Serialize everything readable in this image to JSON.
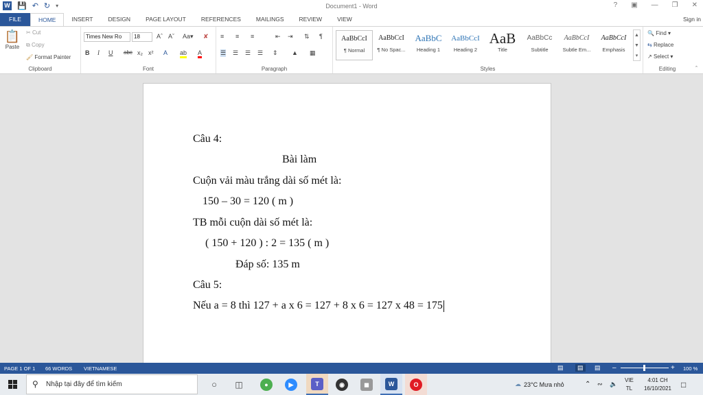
{
  "titlebar": {
    "title": "Document1 - Word",
    "help": "?",
    "word_icon": "W"
  },
  "tabs": [
    "FILE",
    "HOME",
    "INSERT",
    "DESIGN",
    "PAGE LAYOUT",
    "REFERENCES",
    "MAILINGS",
    "REVIEW",
    "VIEW"
  ],
  "sign_in": "Sign in",
  "clipboard": {
    "paste": "Paste",
    "cut": "Cut",
    "copy": "Copy",
    "format_painter": "Format Painter",
    "label": "Clipboard"
  },
  "font": {
    "name": "Times New Ro",
    "size": "18",
    "label": "Font",
    "case": "Aa"
  },
  "paragraph": {
    "label": "Paragraph"
  },
  "styles": {
    "label": "Styles",
    "items": [
      {
        "sample": "AaBbCcI",
        "name": "¶ Normal"
      },
      {
        "sample": "AaBbCcI",
        "name": "¶ No Spac..."
      },
      {
        "sample": "AaBbC",
        "name": "Heading 1"
      },
      {
        "sample": "AaBbCcI",
        "name": "Heading 2"
      },
      {
        "sample": "AaB",
        "name": "Title"
      },
      {
        "sample": "AaBbCc",
        "name": "Subtitle"
      },
      {
        "sample": "AaBbCcI",
        "name": "Subtle Em..."
      },
      {
        "sample": "AaBbCcI",
        "name": "Emphasis"
      }
    ]
  },
  "editing": {
    "find": "Find",
    "replace": "Replace",
    "select": "Select",
    "label": "Editing"
  },
  "document": {
    "lines": [
      "Câu 4:",
      "Bài làm",
      "Cuộn vải màu trắng dài số mét là:",
      "150 – 30 = 120 ( m )",
      "TB mỗi cuộn dài số mét là:",
      "( 150 + 120 ) : 2 = 135 ( m )",
      "Đáp số: 135 m",
      "Câu 5:",
      "Nếu a = 8 thì 127 + a x 6 = 127 + 8 x 6 = 127 x 48 = 175"
    ]
  },
  "status": {
    "page": "PAGE 1 OF 1",
    "words": "66 WORDS",
    "lang": "VIETNAMESE",
    "zoom": "100 %"
  },
  "taskbar": {
    "search_placeholder": "Nhập tại đây để tìm kiếm",
    "weather": "23°C  Mưa nhỏ",
    "lang1": "VIE",
    "lang2": "TL",
    "time": "4:01 CH",
    "date": "16/10/2021"
  },
  "colors": {
    "accent": "#2b579a"
  }
}
